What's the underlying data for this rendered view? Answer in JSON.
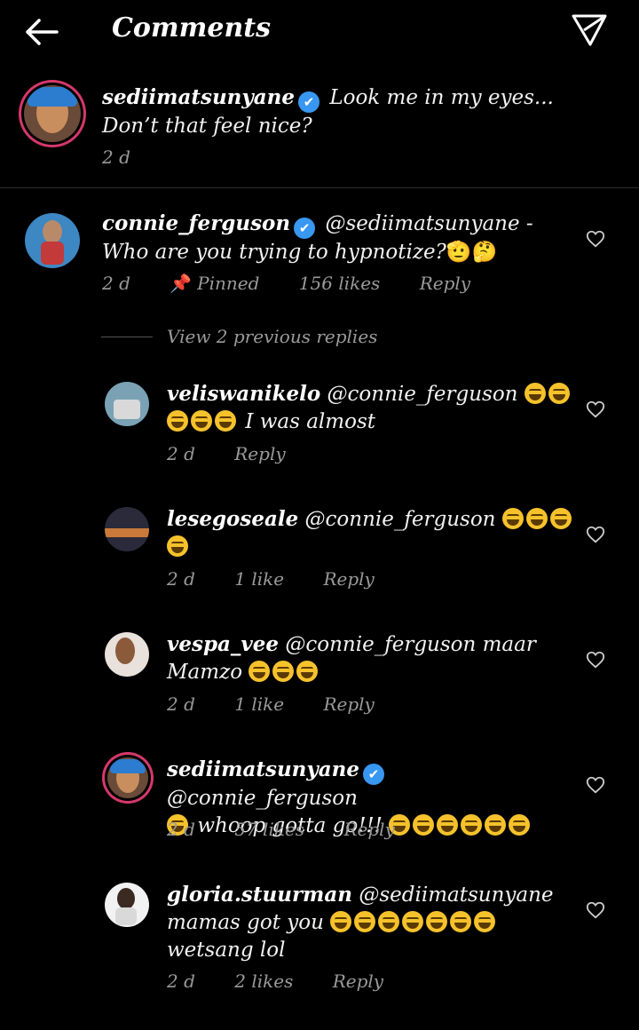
{
  "header": {
    "title": "Comments",
    "back_icon": "arrow-left-icon",
    "send_icon": "paper-plane-icon"
  },
  "caption": {
    "username": "sediimatsunyane",
    "verified": true,
    "text": "Look me in my eyes... Don’t that feel nice?",
    "time": "2 d"
  },
  "pinned_comment": {
    "username": "connie_ferguson",
    "verified": true,
    "text": "@sediimatsunyane - Who are you trying to hypnotize?",
    "emoji": "🫡🤔",
    "time": "2 d",
    "pinned_label": "Pinned",
    "likes": "156 likes",
    "reply_label": "Reply"
  },
  "view_previous": "View 2 previous replies",
  "replies": [
    {
      "username": "veliswanikelo",
      "verified": false,
      "text": "@connie_ferguson",
      "text2": "I was almost",
      "emoji_count_line1": 2,
      "emoji_count_line2": 3,
      "time": "2 d",
      "likes": "",
      "reply_label": "Reply"
    },
    {
      "username": "lesegoseale",
      "verified": false,
      "text": "@connie_ferguson",
      "emoji_count_line1": 3,
      "emoji_count_line2": 1,
      "time": "2 d",
      "likes": "1 like",
      "reply_label": "Reply"
    },
    {
      "username": "vespa_vee",
      "verified": false,
      "text": "@connie_ferguson maar",
      "text2": "Mamzo",
      "emoji_count_line2": 3,
      "time": "2 d",
      "likes": "1 like",
      "reply_label": "Reply"
    },
    {
      "username": "sediimatsunyane",
      "verified": true,
      "text": "@connie_ferguson",
      "text2": "whoop gotta go!!!",
      "emoji_count_line2": 6,
      "time": "2 d",
      "likes": "57 likes",
      "reply_label": "Reply"
    },
    {
      "username": "gloria.stuurman",
      "verified": false,
      "text": "@sediimatsunyane",
      "text2": "mamas got you",
      "text3": "wetsang lol",
      "emoji_count_line2": 7,
      "time": "2 d",
      "likes": "2 likes",
      "reply_label": "Reply"
    }
  ],
  "colors": {
    "background": "#000000",
    "muted_text": "#9a9a9a",
    "verified_badge": "#3897f0",
    "story_ring": "#d6386b"
  }
}
